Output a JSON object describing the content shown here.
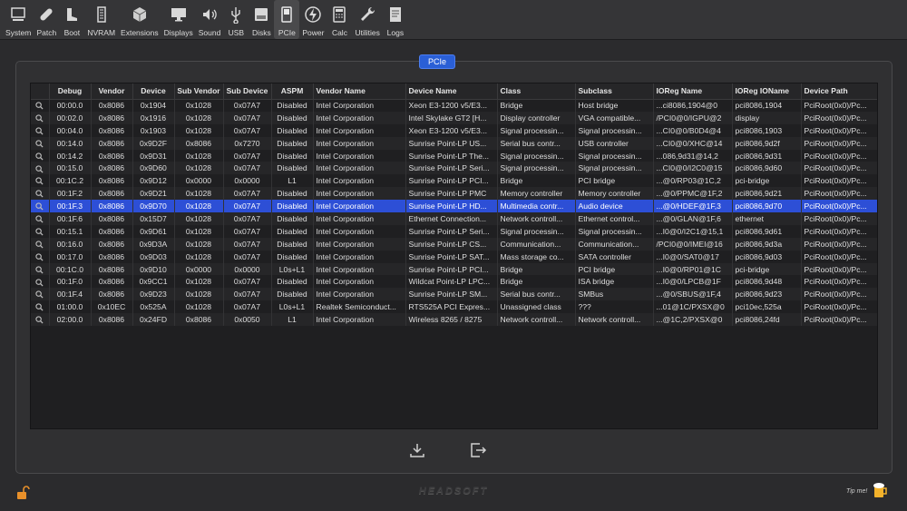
{
  "toolbar": {
    "items": [
      {
        "label": "System",
        "icon": "computer-icon"
      },
      {
        "label": "Patch",
        "icon": "bandage-icon"
      },
      {
        "label": "Boot",
        "icon": "boot-icon"
      },
      {
        "label": "NVRAM",
        "icon": "memory-chip-icon"
      },
      {
        "label": "Extensions",
        "icon": "cube-icon"
      },
      {
        "label": "Displays",
        "icon": "monitor-icon"
      },
      {
        "label": "Sound",
        "icon": "speaker-icon"
      },
      {
        "label": "USB",
        "icon": "usb-icon"
      },
      {
        "label": "Disks",
        "icon": "disk-icon"
      },
      {
        "label": "PCIe",
        "icon": "pcie-card-icon"
      },
      {
        "label": "Power",
        "icon": "lightning-icon"
      },
      {
        "label": "Calc",
        "icon": "calculator-icon"
      },
      {
        "label": "Utilities",
        "icon": "wrench-icon"
      },
      {
        "label": "Logs",
        "icon": "log-icon"
      }
    ],
    "active": "PCIe"
  },
  "panel": {
    "title": "PCIe"
  },
  "table": {
    "headers": [
      "",
      "Debug",
      "Vendor",
      "Device",
      "Sub Vendor",
      "Sub Device",
      "ASPM",
      "Vendor Name",
      "Device Name",
      "Class",
      "Subclass",
      "IOReg Name",
      "IOReg IOName",
      "Device Path"
    ],
    "selected_index": 8,
    "rows": [
      [
        "00:00.0",
        "0x8086",
        "0x1904",
        "0x1028",
        "0x07A7",
        "Disabled",
        "Intel Corporation",
        "Xeon E3-1200 v5/E3...",
        "Bridge",
        "Host bridge",
        "...ci8086,1904@0",
        "pci8086,1904",
        "PciRoot(0x0)/Pc..."
      ],
      [
        "00:02.0",
        "0x8086",
        "0x1916",
        "0x1028",
        "0x07A7",
        "Disabled",
        "Intel Corporation",
        "Intel Skylake GT2 [H...",
        "Display controller",
        "VGA compatible...",
        "/PCI0@0/IGPU@2",
        "display",
        "PciRoot(0x0)/Pc..."
      ],
      [
        "00:04.0",
        "0x8086",
        "0x1903",
        "0x1028",
        "0x07A7",
        "Disabled",
        "Intel Corporation",
        "Xeon E3-1200 v5/E3...",
        "Signal processin...",
        "Signal processin...",
        "...CI0@0/B0D4@4",
        "pci8086,1903",
        "PciRoot(0x0)/Pc..."
      ],
      [
        "00:14.0",
        "0x8086",
        "0x9D2F",
        "0x8086",
        "0x7270",
        "Disabled",
        "Intel Corporation",
        "Sunrise Point-LP US...",
        "Serial bus contr...",
        "USB controller",
        "...CI0@0/XHC@14",
        "pci8086,9d2f",
        "PciRoot(0x0)/Pc..."
      ],
      [
        "00:14.2",
        "0x8086",
        "0x9D31",
        "0x1028",
        "0x07A7",
        "Disabled",
        "Intel Corporation",
        "Sunrise Point-LP The...",
        "Signal processin...",
        "Signal processin...",
        "...086,9d31@14,2",
        "pci8086,9d31",
        "PciRoot(0x0)/Pc..."
      ],
      [
        "00:15.0",
        "0x8086",
        "0x9D60",
        "0x1028",
        "0x07A7",
        "Disabled",
        "Intel Corporation",
        "Sunrise Point-LP Seri...",
        "Signal processin...",
        "Signal processin...",
        "...CI0@0/I2C0@15",
        "pci8086,9d60",
        "PciRoot(0x0)/Pc..."
      ],
      [
        "00:1C.2",
        "0x8086",
        "0x9D12",
        "0x0000",
        "0x0000",
        "L1",
        "Intel Corporation",
        "Sunrise Point-LP PCI...",
        "Bridge",
        "PCI bridge",
        "...@0/RP03@1C,2",
        "pci-bridge",
        "PciRoot(0x0)/Pc..."
      ],
      [
        "00:1F.2",
        "0x8086",
        "0x9D21",
        "0x1028",
        "0x07A7",
        "Disabled",
        "Intel Corporation",
        "Sunrise Point-LP PMC",
        "Memory controller",
        "Memory controller",
        "...@0/PPMC@1F,2",
        "pci8086,9d21",
        "PciRoot(0x0)/Pc..."
      ],
      [
        "00:1F.3",
        "0x8086",
        "0x9D70",
        "0x1028",
        "0x07A7",
        "Disabled",
        "Intel Corporation",
        "Sunrise Point-LP HD...",
        "Multimedia contr...",
        "Audio device",
        "...@0/HDEF@1F,3",
        "pci8086,9d70",
        "PciRoot(0x0)/Pc..."
      ],
      [
        "00:1F.6",
        "0x8086",
        "0x15D7",
        "0x1028",
        "0x07A7",
        "Disabled",
        "Intel Corporation",
        "Ethernet Connection...",
        "Network controll...",
        "Ethernet control...",
        "...@0/GLAN@1F,6",
        "ethernet",
        "PciRoot(0x0)/Pc..."
      ],
      [
        "00:15.1",
        "0x8086",
        "0x9D61",
        "0x1028",
        "0x07A7",
        "Disabled",
        "Intel Corporation",
        "Sunrise Point-LP Seri...",
        "Signal processin...",
        "Signal processin...",
        "...I0@0/I2C1@15,1",
        "pci8086,9d61",
        "PciRoot(0x0)/Pc..."
      ],
      [
        "00:16.0",
        "0x8086",
        "0x9D3A",
        "0x1028",
        "0x07A7",
        "Disabled",
        "Intel Corporation",
        "Sunrise Point-LP CS...",
        "Communication...",
        "Communication...",
        "/PCI0@0/IMEI@16",
        "pci8086,9d3a",
        "PciRoot(0x0)/Pc..."
      ],
      [
        "00:17.0",
        "0x8086",
        "0x9D03",
        "0x1028",
        "0x07A7",
        "Disabled",
        "Intel Corporation",
        "Sunrise Point-LP SAT...",
        "Mass storage co...",
        "SATA controller",
        "...I0@0/SAT0@17",
        "pci8086,9d03",
        "PciRoot(0x0)/Pc..."
      ],
      [
        "00:1C.0",
        "0x8086",
        "0x9D10",
        "0x0000",
        "0x0000",
        "L0s+L1",
        "Intel Corporation",
        "Sunrise Point-LP PCI...",
        "Bridge",
        "PCI bridge",
        "...I0@0/RP01@1C",
        "pci-bridge",
        "PciRoot(0x0)/Pc..."
      ],
      [
        "00:1F.0",
        "0x8086",
        "0x9CC1",
        "0x1028",
        "0x07A7",
        "Disabled",
        "Intel Corporation",
        "Wildcat Point-LP LPC...",
        "Bridge",
        "ISA bridge",
        "...I0@0/LPCB@1F",
        "pci8086,9d48",
        "PciRoot(0x0)/Pc..."
      ],
      [
        "00:1F.4",
        "0x8086",
        "0x9D23",
        "0x1028",
        "0x07A7",
        "Disabled",
        "Intel Corporation",
        "Sunrise Point-LP SM...",
        "Serial bus contr...",
        "SMBus",
        "...@0/SBUS@1F,4",
        "pci8086,9d23",
        "PciRoot(0x0)/Pc..."
      ],
      [
        "01:00.0",
        "0x10EC",
        "0x525A",
        "0x1028",
        "0x07A7",
        "L0s+L1",
        "Realtek Semiconduct...",
        "RTS525A PCI Expres...",
        "Unassigned class",
        "???",
        "...01@1C/PXSX@0",
        "pci10ec,525a",
        "PciRoot(0x0)/Pc..."
      ],
      [
        "02:00.0",
        "0x8086",
        "0x24FD",
        "0x8086",
        "0x0050",
        "L1",
        "Intel Corporation",
        "Wireless 8265 / 8275",
        "Network controll...",
        "Network controll...",
        "...@1C,2/PXSX@0",
        "pci8086,24fd",
        "PciRoot(0x0)/Pc..."
      ]
    ]
  },
  "bottom": {
    "export_icon": "download-icon",
    "exit_icon": "exit-icon",
    "brand": "HEADSOFT",
    "tip_label": "Tip me!"
  },
  "colors": {
    "accent": "#2d4fd6",
    "background": "#2b2b2d"
  }
}
